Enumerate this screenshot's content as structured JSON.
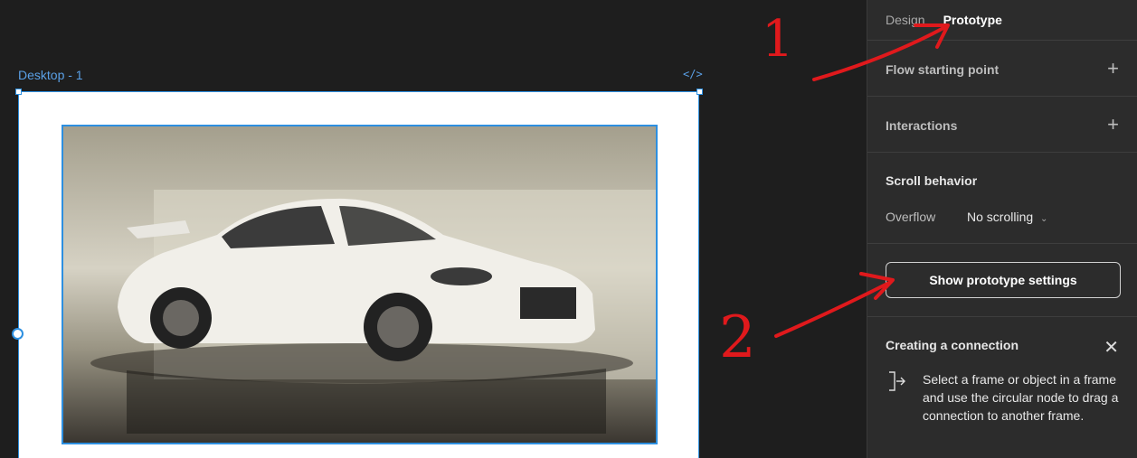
{
  "canvas": {
    "frame_label": "Desktop - 1",
    "code_icon_text": "</>"
  },
  "panel": {
    "tabs": [
      {
        "label": "Design",
        "active": false
      },
      {
        "label": "Prototype",
        "active": true
      }
    ],
    "flow_starting_point": "Flow starting point",
    "interactions": "Interactions",
    "scroll_behavior": {
      "title": "Scroll behavior",
      "overflow_label": "Overflow",
      "overflow_value": "No scrolling"
    },
    "show_settings_button": "Show prototype settings",
    "creating_connection": {
      "title": "Creating a connection",
      "body": "Select a frame or object in a frame and use the circular node to drag a connection to another frame."
    }
  },
  "annotations": [
    "1",
    "2"
  ],
  "colors": {
    "accent": "#2d8fe0",
    "annotation": "#e0191c",
    "panel_bg": "#2c2c2c",
    "canvas_bg": "#1e1e1e"
  }
}
